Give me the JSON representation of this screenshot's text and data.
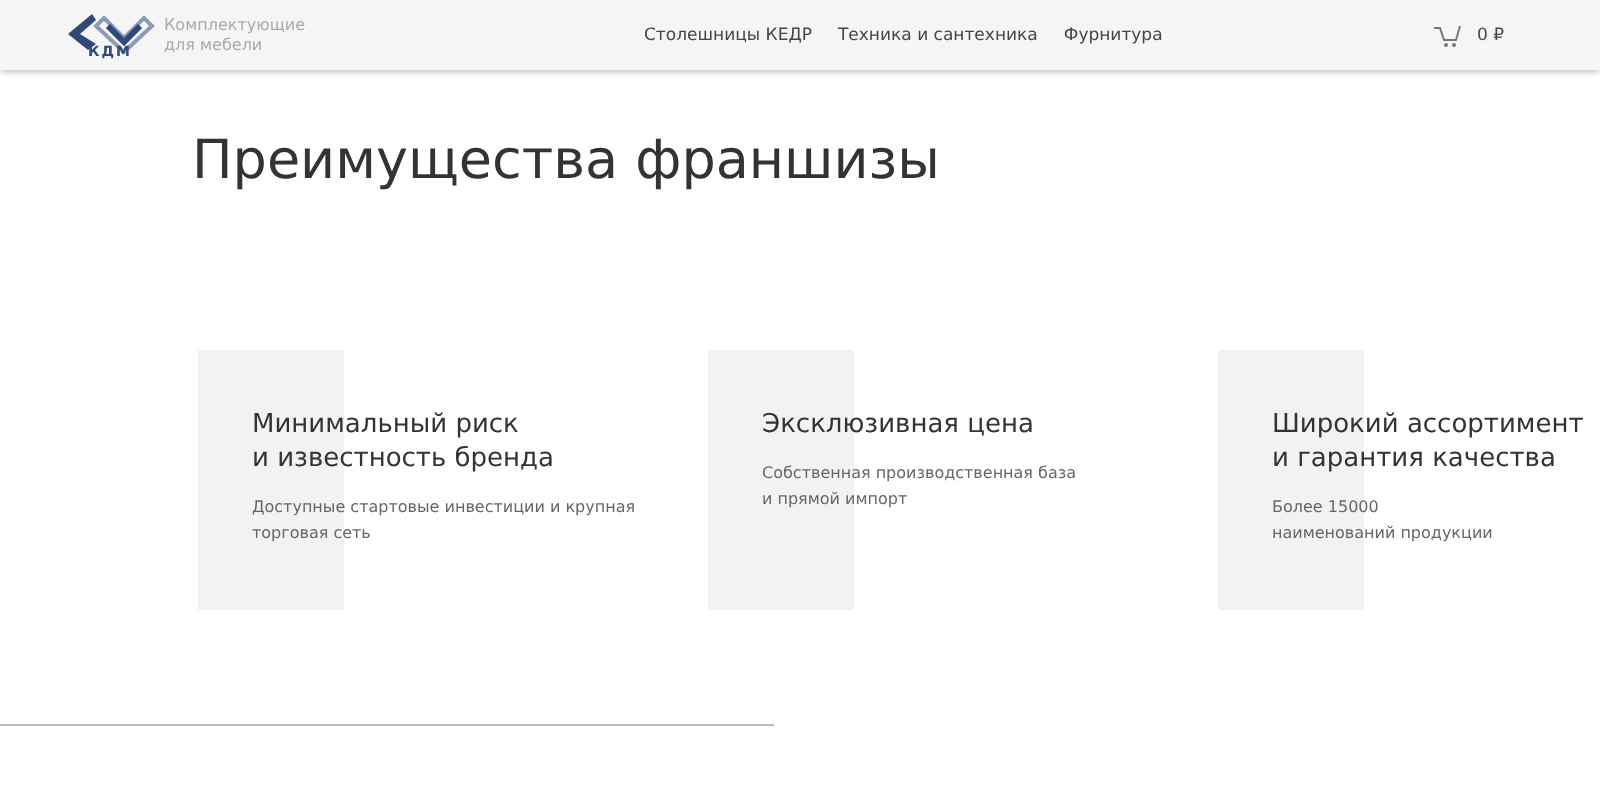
{
  "header": {
    "logo_mark": "КДМ",
    "logo_text": "Комплектующие\nдля мебели",
    "nav": [
      "Столешницы КЕДР",
      "Техника и сантехника",
      "Фурнитура"
    ],
    "cart_total": "0 ₽"
  },
  "heading": "Преимущества франшизы",
  "advantages": [
    {
      "title": "Минимальный риск\nи известность бренда",
      "text": "Доступные стартовые инвестиции и крупная\nторговая сеть"
    },
    {
      "title": "Эксклюзивная цена",
      "text": "Собственная производственная база\nи прямой импорт"
    },
    {
      "title": "Широкий ассортимент\nи гарантия качества",
      "text": "Более 15000\nнаименований продукции"
    }
  ]
}
